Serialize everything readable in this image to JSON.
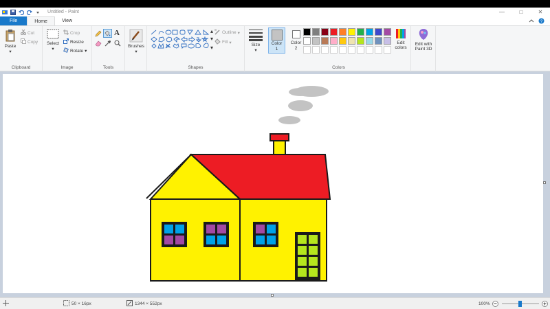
{
  "window": {
    "title": "Untitled - Paint"
  },
  "tabs": {
    "file": "File",
    "home": "Home",
    "view": "View"
  },
  "clipboard": {
    "paste": "Paste",
    "cut": "Cut",
    "copy": "Copy",
    "label": "Clipboard"
  },
  "image": {
    "select": "Select",
    "crop": "Crop",
    "resize": "Resize",
    "rotate": "Rotate",
    "label": "Image"
  },
  "tools": {
    "label": "Tools",
    "text_tool": "A"
  },
  "brushes": {
    "label": "Brushes"
  },
  "shapes": {
    "outline": "Outline",
    "fill": "Fill",
    "label": "Shapes"
  },
  "size": {
    "label": "Size"
  },
  "colors": {
    "color1_label": "Color 1",
    "color2_label": "Color 2",
    "color1": "#c3c3c3",
    "color2": "#ffffff",
    "edit_colors": "Edit colors",
    "label": "Colors",
    "palette_row1": [
      "#000000",
      "#7f7f7f",
      "#880015",
      "#ed1c24",
      "#ff7f27",
      "#fff200",
      "#22b14c",
      "#00a2e8",
      "#3f48cc",
      "#a349a4"
    ],
    "palette_row2": [
      "#ffffff",
      "#c3c3c3",
      "#b97a57",
      "#ffaec9",
      "#ffc90e",
      "#efe4b0",
      "#b5e61d",
      "#99d9ea",
      "#7092be",
      "#c8bfe7"
    ],
    "palette_row3": [
      "#ffffff",
      "#ffffff",
      "#ffffff",
      "#ffffff",
      "#ffffff",
      "#ffffff",
      "#ffffff",
      "#ffffff",
      "#ffffff",
      "#ffffff"
    ]
  },
  "paint3d": {
    "label": "Edit with Paint 3D"
  },
  "drawing": {
    "wall_color": "#fff200",
    "roof_color": "#ed1c24",
    "outline_color": "#1a1a1a",
    "window_blue": "#00a2e8",
    "window_purple": "#a349a4",
    "door_color": "#b5e61d",
    "smoke_color": "#c3c3c3"
  },
  "status": {
    "selection_size": "50 × 16px",
    "image_size": "1344 × 552px",
    "zoom": "100%"
  }
}
